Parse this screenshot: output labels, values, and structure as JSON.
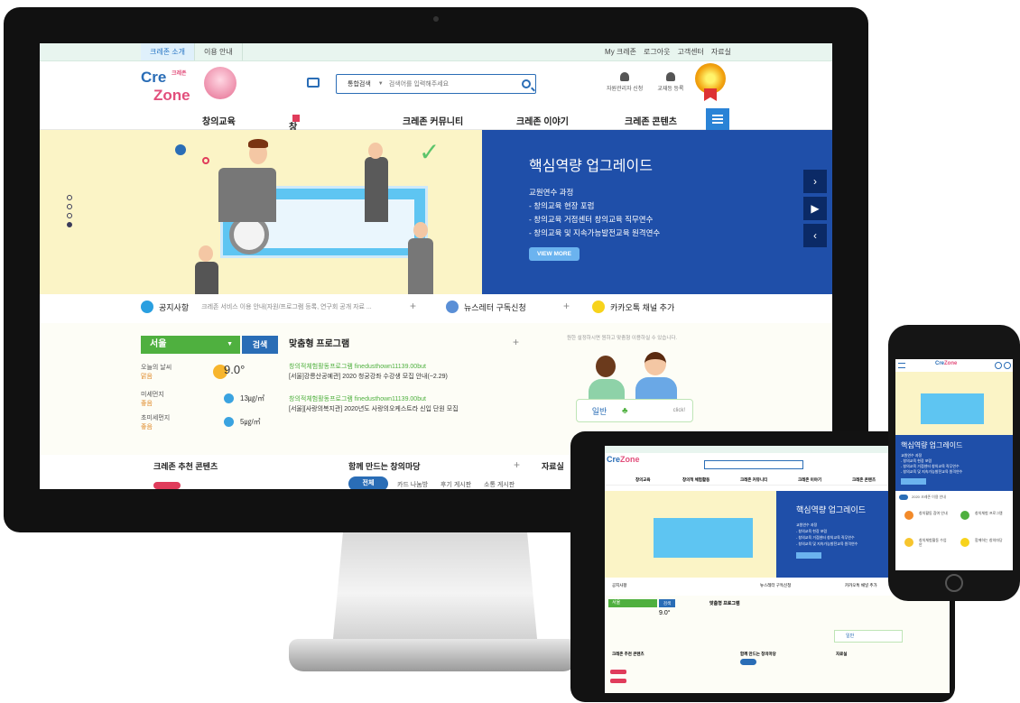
{
  "util": {
    "left": [
      "크레존 소개",
      "이용 안내"
    ],
    "right": [
      "My 크레존",
      "로그아웃",
      "고객센터",
      "자료실"
    ]
  },
  "header": {
    "logo_cre": "Cre",
    "logo_zone": "Zone",
    "logo_mini": "크레존",
    "search_select": "통합검색",
    "search_placeholder": "검색어를 입력해주세요",
    "link_1": "자원관리자 신청",
    "link_2": "교재등 등록"
  },
  "gnb": [
    "창의교육",
    "창의적 체험활동",
    "크레존 커뮤니티",
    "크레존 이야기",
    "크레존 콘텐츠"
  ],
  "hero": {
    "title": "핵심역량 업그레이드",
    "lines": [
      "교원연수 과정",
      "- 창의교육 현장 포럼",
      "- 창의교육 거점센터 창의교육 직무연수",
      "- 창의교육 및 지속가능발전교육 원격연수"
    ],
    "button": "VIEW MORE",
    "arrows": [
      "›",
      "▶",
      "‹"
    ]
  },
  "notice": {
    "label": "공지사항",
    "text": "크레존 서비스 이용 안내(자원/프로그램 등록, 연구회 공개 자료 ...",
    "newsletter": "뉴스레터 구독신청",
    "kakao": "카카오톡 채널 추가",
    "plus": "+"
  },
  "weather": {
    "region": "서울",
    "search": "검색",
    "today_label": "오늘의 날씨",
    "today_status": "맑음",
    "temperature": "9.0°",
    "dust_label": "미세먼지",
    "dust_status": "좋음",
    "dust_value": "13㎍/㎥",
    "fine_dust_label": "초미세먼지",
    "fine_dust_status": "좋음",
    "fine_dust_value": "5㎍/㎥"
  },
  "programs": {
    "title": "맞춤형 프로그램",
    "plus": "+",
    "items": [
      {
        "a": "창의적체험활동프로그램 finedusthown11139.00but",
        "t": "[서울]강릉산공예관] 2020 청궁강좌 수강생 모집 안내(~2.29)"
      },
      {
        "a": "창의적체험활동프로그램 finedusthown11139.00but",
        "t": "[서울][사랑의복지관] 2020년도 사랑의오케스트라 신입 단원 모집"
      }
    ]
  },
  "ad": {
    "caption": "원한 설정하시면 원하고 맞춤형 이용하실 수 있습니다.",
    "left": "일반",
    "right": "click!"
  },
  "lower": {
    "col1": "크레존 추천 콘텐츠",
    "col2": "함께 만드는 창의마당",
    "col3": "자료실",
    "plus": "+",
    "tab_all": "전체",
    "tabs": [
      "카드 나눔방",
      "후기 게시판",
      "소통 게시판"
    ]
  },
  "phone": {
    "notice": "2020 크레존 이용 안내",
    "cells": [
      "창의활동 참여 안내",
      "창의체험 프로그램",
      "창의체험활동 수업안",
      "함께하는 창의마당"
    ]
  },
  "colors": {
    "brand_blue": "#2a6db6",
    "hero_blue": "#1f4fa9",
    "weather_green": "#4fb03f",
    "hero_yellow": "#fbf4c6"
  }
}
